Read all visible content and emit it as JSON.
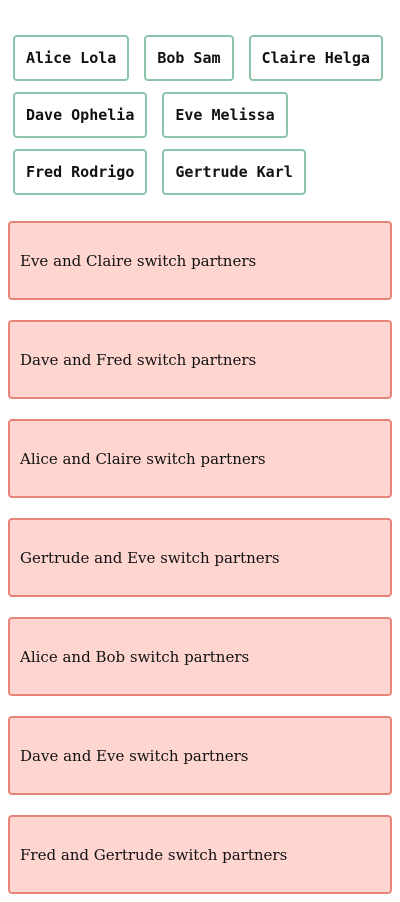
{
  "couples": [
    {
      "label": "Alice Lola"
    },
    {
      "label": "Bob Sam"
    },
    {
      "label": "Claire Helga"
    },
    {
      "label": "Dave Ophelia"
    },
    {
      "label": "Eve Melissa"
    },
    {
      "label": "Fred Rodrigo"
    },
    {
      "label": "Gertrude Karl"
    }
  ],
  "swaps": [
    {
      "text": "Eve and Claire switch partners"
    },
    {
      "text": "Dave and Fred switch partners"
    },
    {
      "text": "Alice and Claire switch partners"
    },
    {
      "text": "Gertrude and Eve switch partners"
    },
    {
      "text": "Alice and Bob switch partners"
    },
    {
      "text": "Dave and Eve switch partners"
    },
    {
      "text": "Fred and Gertrude switch partners"
    }
  ],
  "colors": {
    "chip_border": "#8cc4aa",
    "card_background": "#ffd5d0",
    "card_border": "#e8837a"
  }
}
